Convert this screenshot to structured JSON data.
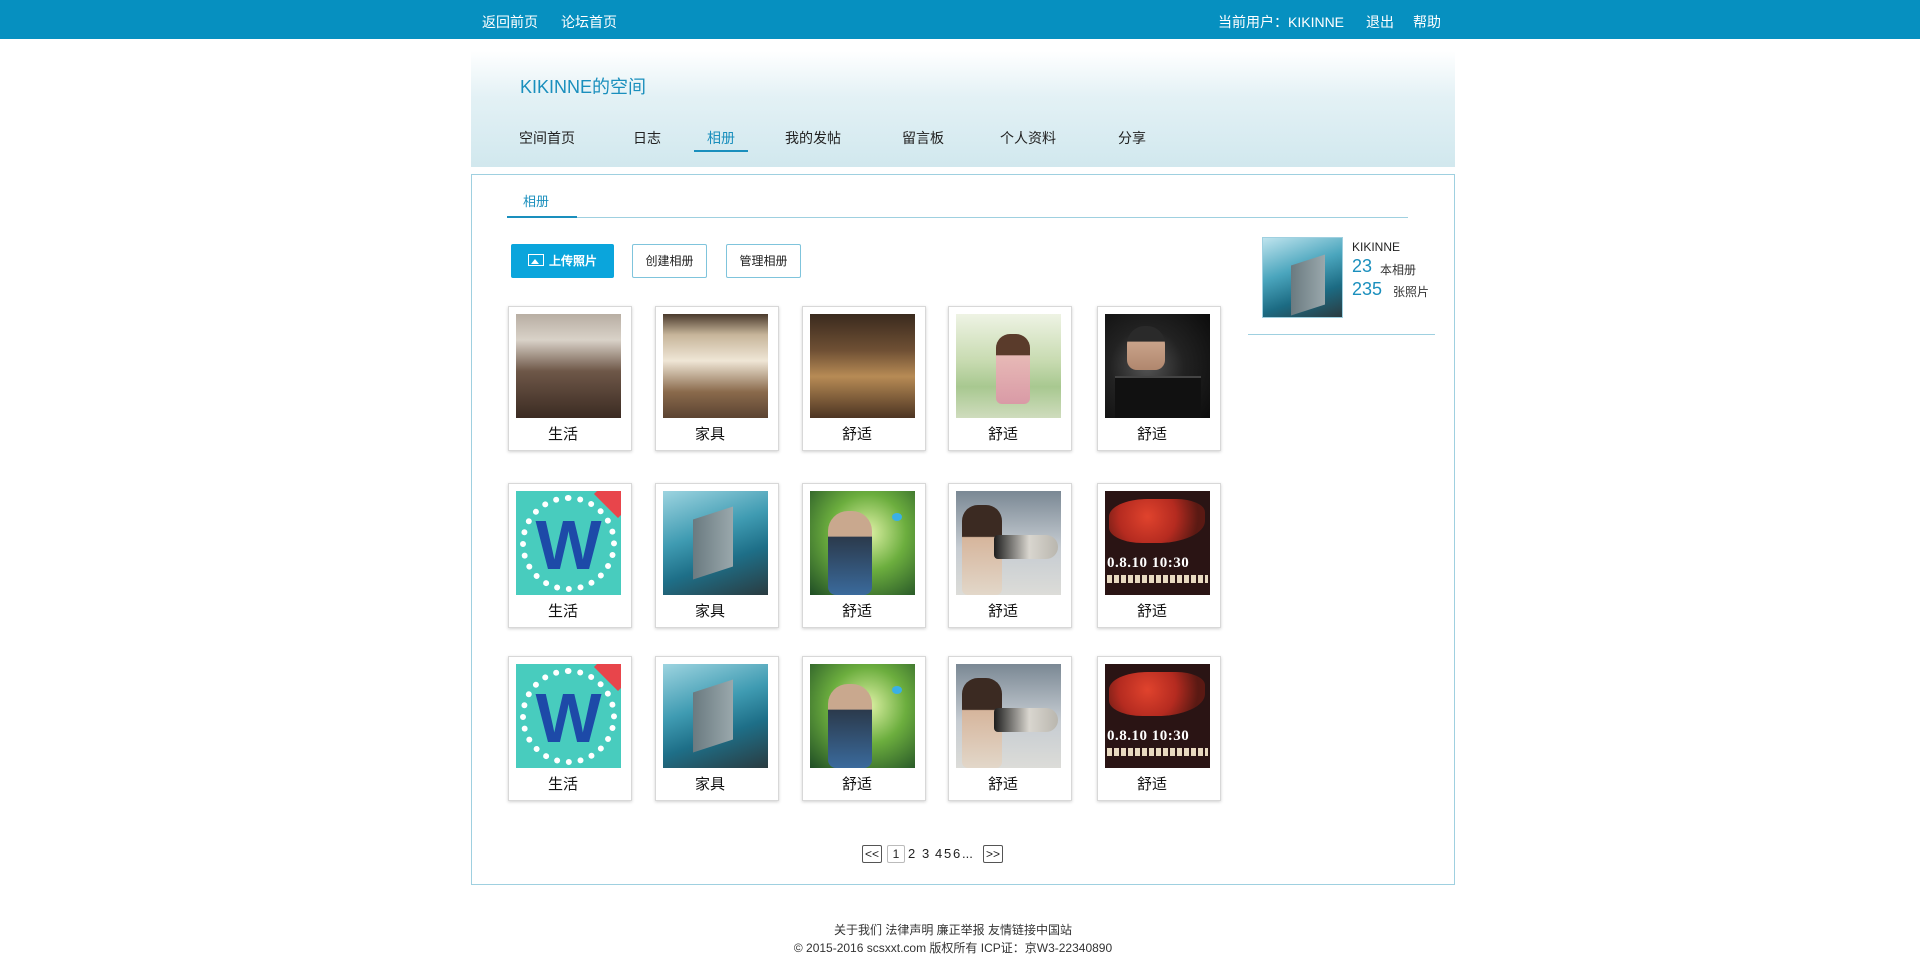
{
  "topbar": {
    "home_link": "返回前页",
    "forum_link": "论坛首页",
    "current_user": "当前用户：KIKINNE",
    "logout": "退出",
    "help": "帮助"
  },
  "header": {
    "site_title": "KIKINNE的空间",
    "nav": [
      {
        "label": "空间首页"
      },
      {
        "label": "日志"
      },
      {
        "label": "相册",
        "active": true
      },
      {
        "label": "我的发帖"
      },
      {
        "label": "留言板"
      },
      {
        "label": "个人资料"
      },
      {
        "label": "分享"
      }
    ]
  },
  "panel": {
    "tab": "相册",
    "buttons": {
      "upload": "上传照片",
      "create": "创建相册",
      "manage": "管理相册"
    },
    "albums": [
      {
        "label": "生活",
        "icon": "living-room-photo"
      },
      {
        "label": "家具",
        "icon": "furniture-room-photo"
      },
      {
        "label": "舒适",
        "icon": "cozy-room-photo"
      },
      {
        "label": "舒适",
        "icon": "girl-binoculars-photo"
      },
      {
        "label": "舒适",
        "icon": "tech-man-photo"
      },
      {
        "label": "生活",
        "icon": "w-logo-photo"
      },
      {
        "label": "家具",
        "icon": "pool-block-photo"
      },
      {
        "label": "舒适",
        "icon": "vr-man-photo"
      },
      {
        "label": "舒适",
        "icon": "camera-lens-photo"
      },
      {
        "label": "舒适",
        "icon": "world-map-photo",
        "caption": "0.8.10 10:30"
      },
      {
        "label": "生活",
        "icon": "w-logo-photo"
      },
      {
        "label": "家具",
        "icon": "pool-block-photo"
      },
      {
        "label": "舒适",
        "icon": "vr-man-photo"
      },
      {
        "label": "舒适",
        "icon": "camera-lens-photo"
      },
      {
        "label": "舒适",
        "icon": "world-map-photo",
        "caption": "0.8.10 10:30"
      }
    ]
  },
  "profile": {
    "name": "KIKINNE",
    "album_count": "23",
    "album_label": "本相册",
    "photo_count": "235",
    "photo_label": "张照片"
  },
  "pagination": {
    "prev": "<<",
    "next": ">>",
    "pages": [
      "1",
      "2",
      "3",
      "4",
      "5",
      "6"
    ],
    "current": "1",
    "ellipsis": "..."
  },
  "footer": {
    "links": "关于我们 法律声明 廉正举报 友情链接中国站",
    "copyright": "© 2015-2016 scsxxt.com 版权所有 ICP证：京W3-22340890"
  },
  "colors": {
    "topbar": "#0690c0",
    "accent": "#1a8fbd",
    "primary_button": "#0aa5dc"
  }
}
